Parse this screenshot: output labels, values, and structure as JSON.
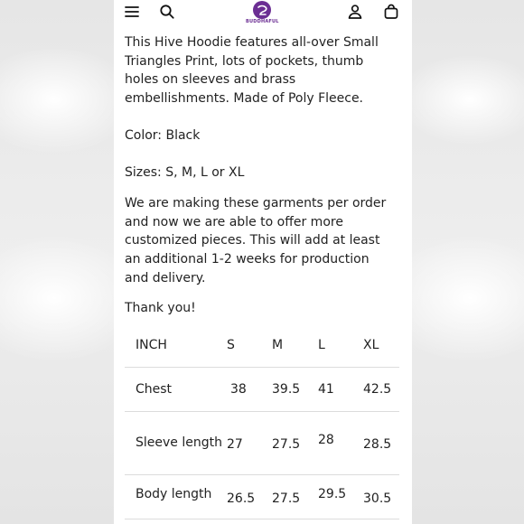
{
  "header": {
    "brand": "BUDDHAFUL",
    "icons": [
      "menu-icon",
      "search-icon",
      "account-icon",
      "bag-icon"
    ],
    "brand_color": "#6b2e93"
  },
  "description": {
    "intro": "This Hive Hoodie features all-over Small Triangles Print, lots of pockets, thumb holes on sleeves and brass embellishments. Made of Poly Fleece.",
    "color": "Color: Black",
    "sizes": "Sizes: S, M, L or XL",
    "note": "We are making these garments per order and now we are able to offer more customized pieces. This will add at least an additional 1-2 weeks for production and delivery.",
    "thanks": "Thank you!"
  },
  "size_chart": {
    "headers": [
      "INCH",
      "S",
      "M",
      "L",
      "XL"
    ],
    "rows": [
      {
        "label": "Chest",
        "values": [
          "38",
          "39.5",
          "41",
          "42.5"
        ]
      },
      {
        "label": "Sleeve length",
        "values": [
          "27",
          "27.5",
          "28",
          "28.5"
        ]
      },
      {
        "label": "Body length",
        "values": [
          "26.5",
          "27.5",
          "29.5",
          "30.5"
        ]
      }
    ]
  }
}
